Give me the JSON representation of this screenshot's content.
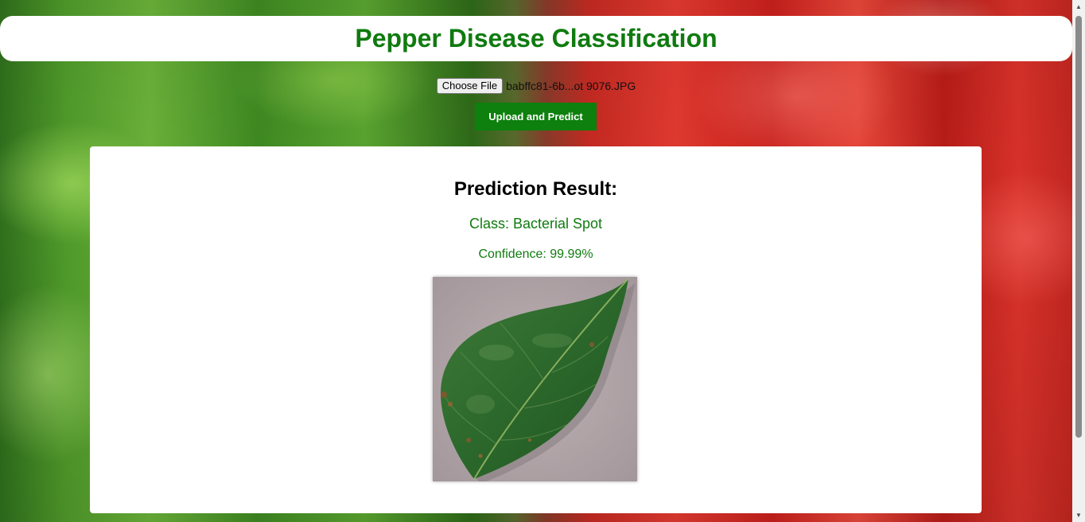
{
  "header": {
    "title": "Pepper Disease Classification"
  },
  "upload": {
    "choose_label": "Choose File",
    "file_name": "babffc81-6b...ot 9076.JPG",
    "predict_label": "Upload and Predict"
  },
  "result": {
    "title": "Prediction Result:",
    "class_text": "Class: Bacterial Spot",
    "confidence_text": "Confidence: 99.99%"
  },
  "colors": {
    "accent": "#0f7b0f",
    "button": "#0d800d"
  },
  "icons": {
    "scroll_up": "scroll-up-arrow-icon",
    "scroll_down": "scroll-down-arrow-icon"
  }
}
